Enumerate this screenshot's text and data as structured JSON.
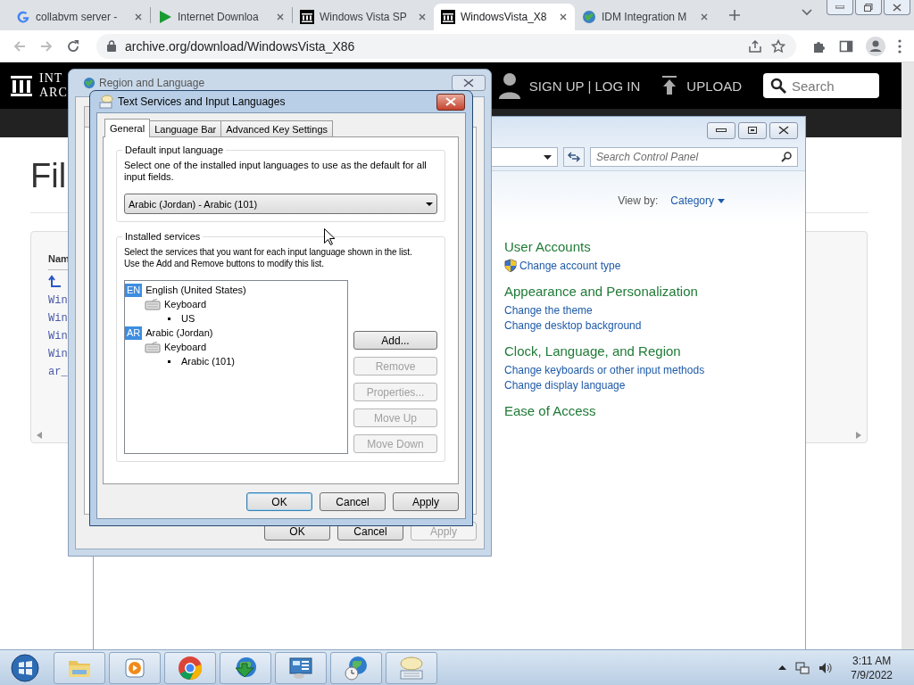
{
  "browser": {
    "tabs": [
      {
        "kind": "google",
        "title": "collabvm server -",
        "selected": false
      },
      {
        "kind": "play",
        "title": "Internet Downloa",
        "selected": false
      },
      {
        "kind": "archive",
        "title": "Windows Vista SP",
        "selected": false
      },
      {
        "kind": "archive",
        "title": "WindowsVista_X8",
        "selected": true
      },
      {
        "kind": "globe",
        "title": "IDM Integration M",
        "selected": false
      }
    ],
    "address": "archive.org/download/WindowsVista_X86"
  },
  "page": {
    "logo": [
      "INT",
      "ARC"
    ],
    "nav": [
      "SIGN UP | LOG IN",
      "UPLOAD"
    ],
    "search": {
      "placeholder": "Search"
    },
    "heading": "Fil",
    "file_list": {
      "column_1": "Nam",
      "rows": [
        "Win",
        "Win",
        "Win",
        "Win",
        "ar_"
      ]
    }
  },
  "control_panel": {
    "search": {
      "placeholder": "Search Control Panel"
    },
    "view_by": {
      "label": "View by:",
      "value": "Category"
    },
    "categories": [
      {
        "title": "User Accounts",
        "links": [
          {
            "kind": "shield",
            "text": "Change account type"
          }
        ]
      },
      {
        "title": "Appearance and Personalization",
        "links": [
          {
            "kind": "plain",
            "text": "Change the theme"
          },
          {
            "kind": "plain",
            "text": "Change desktop background"
          }
        ]
      },
      {
        "title": "Clock, Language, and Region",
        "links": [
          {
            "kind": "plain",
            "text": "Change keyboards or other input methods"
          },
          {
            "kind": "plain",
            "text": "Change display language"
          }
        ]
      },
      {
        "title": "Ease of Access"
      }
    ]
  },
  "region_window": {
    "title": "Region and Language",
    "buttons": [
      {
        "label": "OK",
        "disabled": false
      },
      {
        "label": "Cancel",
        "disabled": false
      },
      {
        "label": "Apply",
        "disabled": true
      }
    ]
  },
  "text_services": {
    "title": "Text Services and Input Languages",
    "tabs": [
      {
        "label": "General",
        "selected": true
      },
      {
        "label": "Language Bar",
        "selected": false
      },
      {
        "label": "Advanced Key Settings",
        "selected": false
      }
    ],
    "default_language": {
      "heading": "Default input language",
      "description": "Select one of the installed input languages to use as the default for all input fields.",
      "value": "Arabic (Jordan) - Arabic (101)"
    },
    "installed_services": {
      "heading": "Installed services",
      "description": [
        "Select the services that you want for each input language shown in the list.",
        "Use the Add and Remove buttons to modify this list."
      ],
      "tree": [
        {
          "kind": "language",
          "tag": "EN",
          "label": "English (United States)",
          "children": [
            {
              "kind": "category",
              "label": "Keyboard",
              "children": [
                {
                  "kind": "service",
                  "label": "US"
                }
              ]
            }
          ]
        },
        {
          "kind": "language",
          "tag": "AR",
          "label": "Arabic (Jordan)",
          "children": [
            {
              "kind": "category",
              "label": "Keyboard",
              "children": [
                {
                  "kind": "service",
                  "label": "Arabic (101)"
                }
              ]
            }
          ]
        }
      ],
      "buttons": [
        {
          "label": "Add...",
          "disabled": false
        },
        {
          "label": "Remove",
          "disabled": true
        },
        {
          "label": "Properties...",
          "disabled": true
        },
        {
          "label": "Move Up",
          "disabled": true
        },
        {
          "label": "Move Down",
          "disabled": true
        }
      ]
    },
    "buttons": [
      {
        "label": "OK",
        "default": true,
        "disabled": false
      },
      {
        "label": "Cancel",
        "default": false,
        "disabled": false
      },
      {
        "label": "Apply",
        "default": false,
        "disabled": false
      }
    ]
  },
  "taskbar": {
    "apps": [
      {
        "kind": "folder"
      },
      {
        "kind": "media"
      },
      {
        "kind": "chrome"
      },
      {
        "kind": "downloader"
      },
      {
        "kind": "control-panel"
      },
      {
        "kind": "globe-clock"
      },
      {
        "kind": "keyboard"
      }
    ],
    "clock": {
      "time": "3:11 AM",
      "date": "7/9/2022"
    }
  }
}
